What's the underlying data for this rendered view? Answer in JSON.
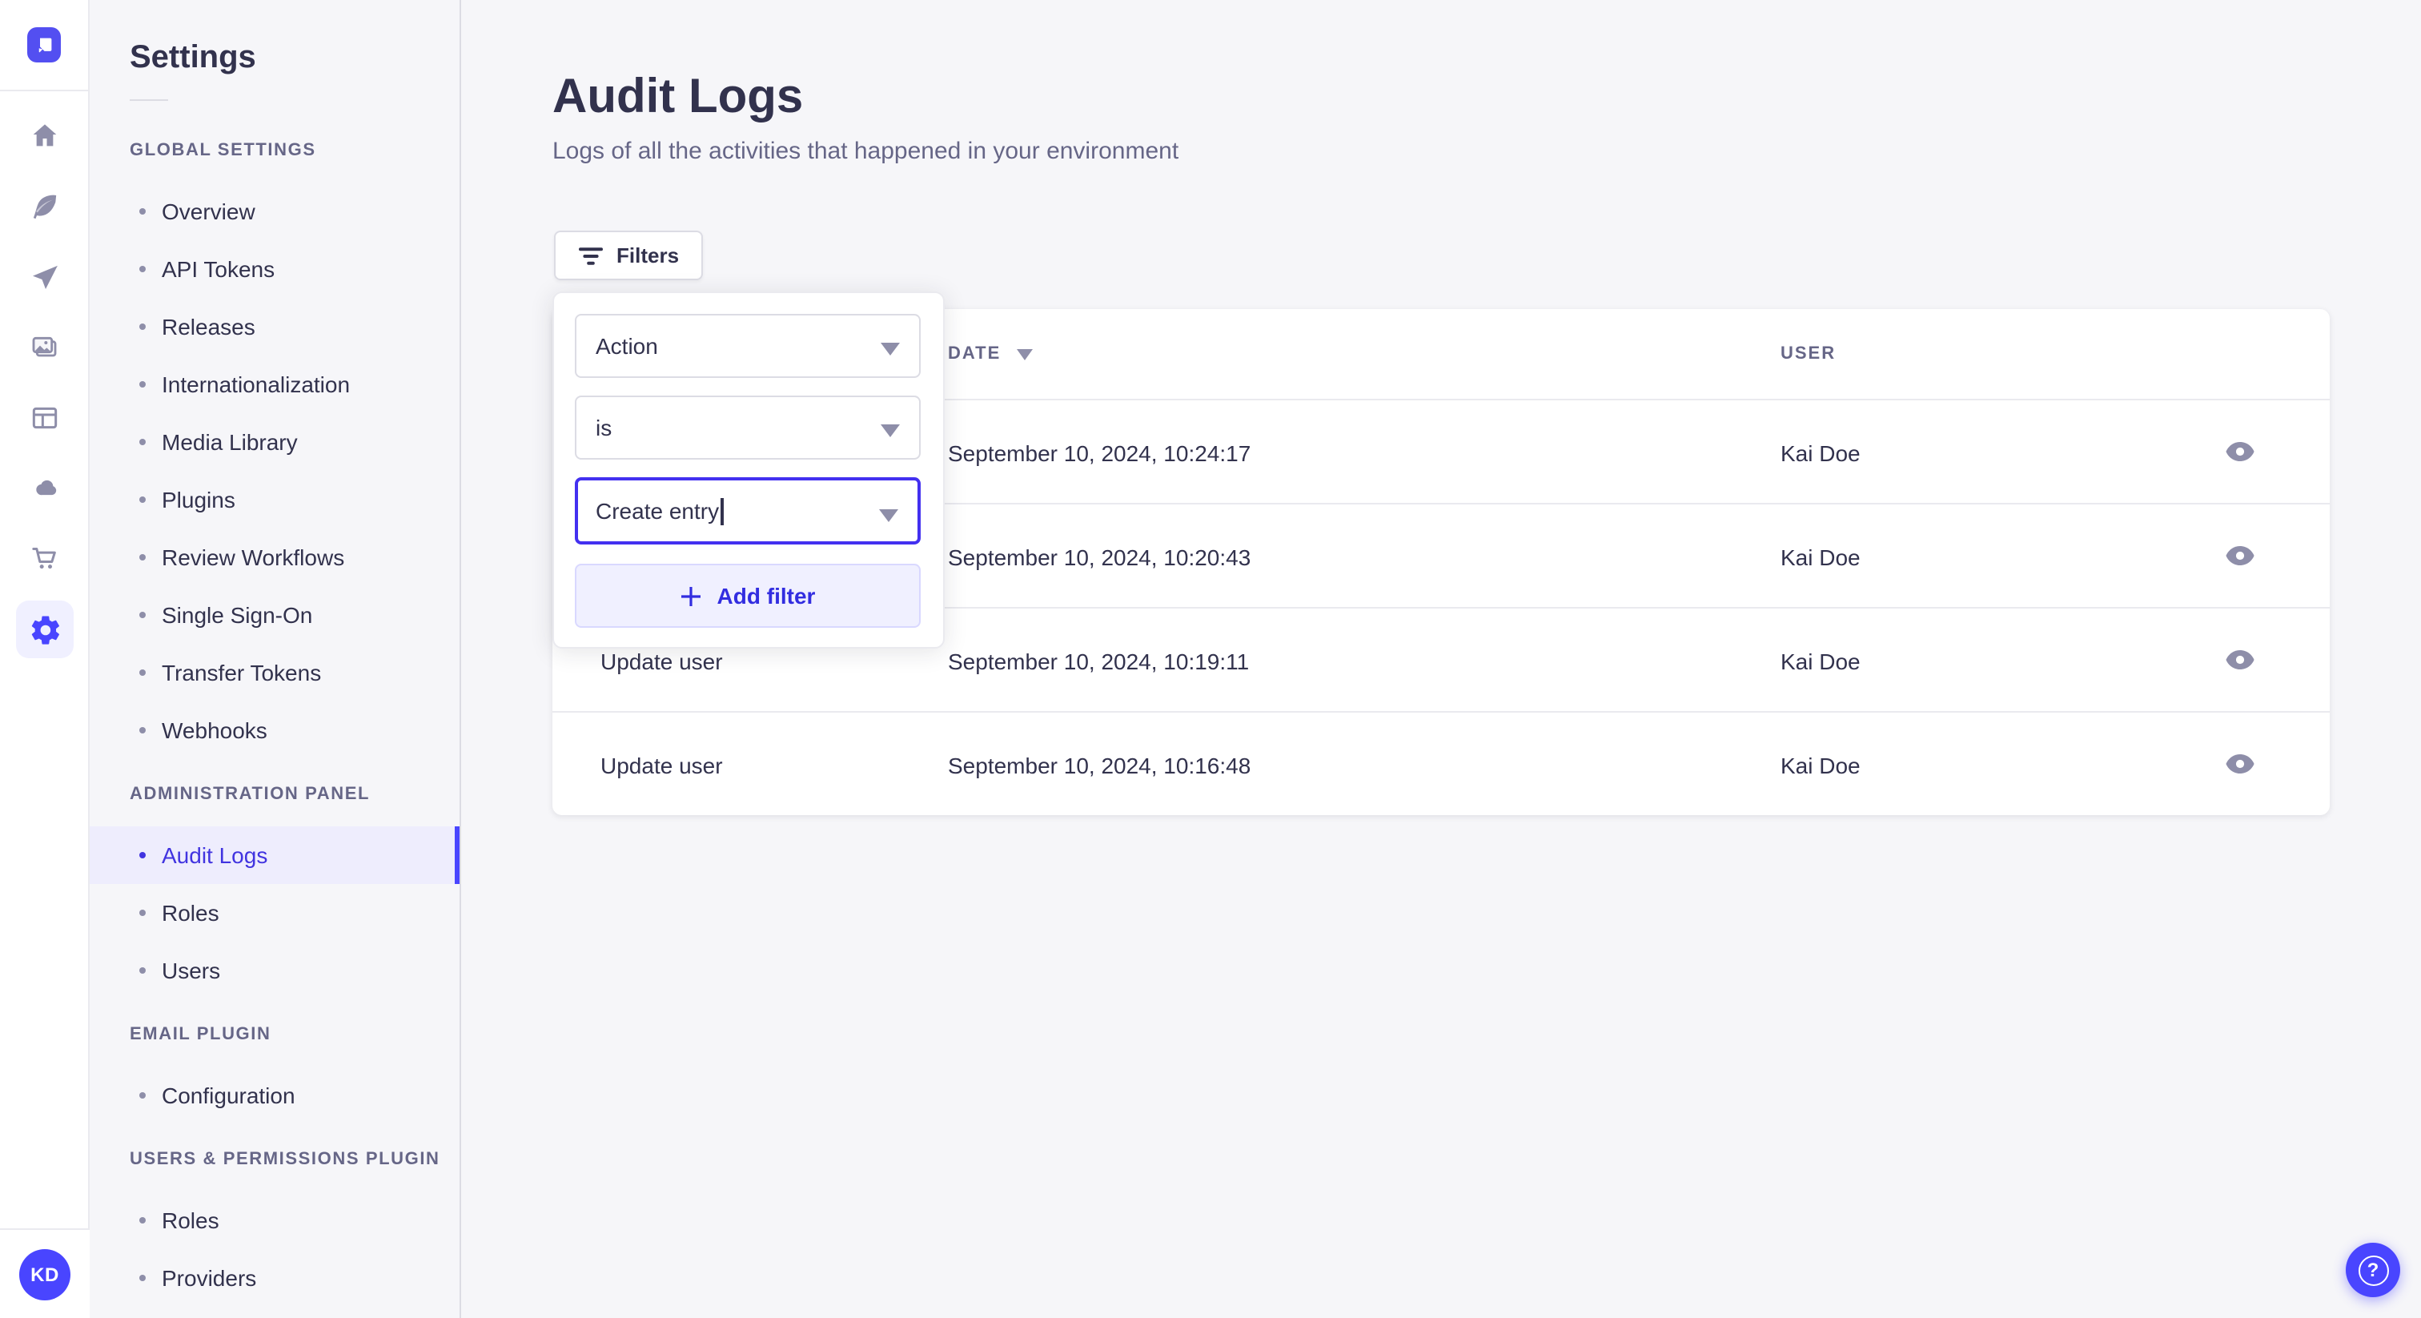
{
  "colors": {
    "primary": "#4945ff",
    "primary_light_bg": "#f0f0ff",
    "active_item_bg": "#eeedfd",
    "text_dark": "#32324d",
    "text_muted": "#666687",
    "icon_gray": "#8e8ea9",
    "border": "#eaeaef",
    "page_bg": "#f6f6f9"
  },
  "rail": {
    "logo_icon": "strapi-logo",
    "icons": [
      "home-icon",
      "feather-icon",
      "paper-plane-icon",
      "media-library-icon",
      "layout-icon",
      "cloud-icon",
      "cart-icon",
      "gear-icon"
    ],
    "avatar_initials": "KD"
  },
  "sidenav": {
    "title": "Settings",
    "sections": [
      {
        "label": "GLOBAL SETTINGS",
        "items": [
          {
            "label": "Overview"
          },
          {
            "label": "API Tokens"
          },
          {
            "label": "Releases"
          },
          {
            "label": "Internationalization"
          },
          {
            "label": "Media Library"
          },
          {
            "label": "Plugins"
          },
          {
            "label": "Review Workflows"
          },
          {
            "label": "Single Sign-On"
          },
          {
            "label": "Transfer Tokens"
          },
          {
            "label": "Webhooks"
          }
        ]
      },
      {
        "label": "ADMINISTRATION PANEL",
        "items": [
          {
            "label": "Audit Logs",
            "active": true
          },
          {
            "label": "Roles"
          },
          {
            "label": "Users"
          }
        ]
      },
      {
        "label": "EMAIL PLUGIN",
        "items": [
          {
            "label": "Configuration"
          }
        ]
      },
      {
        "label": "USERS & PERMISSIONS PLUGIN",
        "items": [
          {
            "label": "Roles"
          },
          {
            "label": "Providers"
          }
        ]
      }
    ]
  },
  "header": {
    "title": "Audit Logs",
    "subtitle": "Logs of all the activities that happened in your environment"
  },
  "toolbar": {
    "filters_label": "Filters"
  },
  "filter_popover": {
    "field_value": "Action",
    "operator_value": "is",
    "value_input": "Create entry",
    "add_filter_label": "Add filter"
  },
  "table": {
    "headers": {
      "action": "",
      "date": "DATE",
      "user": "USER"
    },
    "rows": [
      {
        "action": "",
        "date": "September 10, 2024, 10:24:17",
        "user": "Kai Doe"
      },
      {
        "action": "",
        "date": "September 10, 2024, 10:20:43",
        "user": "Kai Doe"
      },
      {
        "action": "Update user",
        "date": "September 10, 2024, 10:19:11",
        "user": "Kai Doe"
      },
      {
        "action": "Update user",
        "date": "September 10, 2024, 10:16:48",
        "user": "Kai Doe"
      }
    ]
  },
  "help": {
    "icon": "question-mark-icon"
  }
}
